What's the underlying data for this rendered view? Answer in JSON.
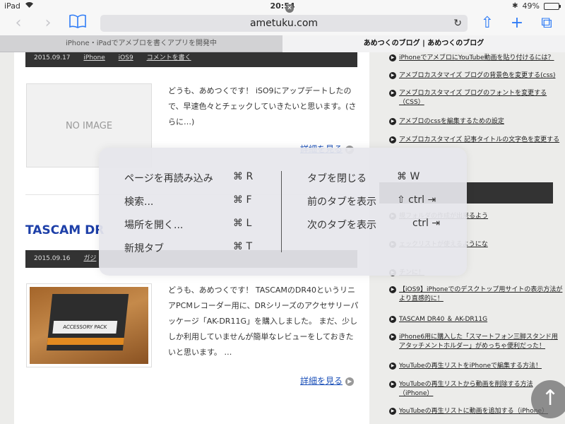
{
  "status": {
    "device": "iPad",
    "time": "20:54",
    "battery": "49%",
    "battery_level": 0.49
  },
  "toolbar": {
    "url": "ametuku.com",
    "back": "‹",
    "forward": "›",
    "share": "⇧",
    "add": "+",
    "tabs": "⧉"
  },
  "tabs": [
    {
      "label": "iPhone・iPadでアメブロを書くアプリを開発中"
    },
    {
      "label": "あめつくのブログ | あめつくのブログ"
    }
  ],
  "posts": [
    {
      "date": "2015.09.17",
      "category": "iPhone",
      "tag": "iOS9",
      "comment": "コメントを書く",
      "thumb": "NO IMAGE",
      "excerpt": "どうも、あめつくです！ iSO9にアップデートしたので、早速色々とチェックしていきたいと思います。(さらに…)",
      "more": "詳細を見る"
    },
    {
      "title": "TASCAM DR",
      "date": "2015.09.16",
      "category": "ガジ",
      "thumb_text": "ACCESSORY PACK",
      "excerpt": "どうも、あめつくです！ TASCAMのDR40というリニアPCMレコーダー用に、DRシリーズのアクセサリーパッケージ「AK-DR11G」を購入しました。 まだ、少ししか利用していませんが簡単なレビューをしておきたいと思います。 …",
      "more": "詳細を見る"
    }
  ],
  "sidebar": {
    "items_top": [
      "iPhoneでアメブロにYouTube動画を貼り付けるには？",
      "アメブロカスタマイズ ブログの背景色を変更する(css)",
      "アメブロカスタマイズ ブログのフォントを変更する（CSS）",
      "アメブロのcssを編集するための設定",
      "アメブロカスタマイズ 記事タイトルの文字色を変更する"
    ],
    "items_partial": [
      "規フォルダの作成が出来るよう",
      "ェックリストが使えるようにな",
      "チンに！"
    ],
    "items_bottom": [
      "【iOS9】iPhoneでのデスクトップ用サイトの表示方法がより直感的に！",
      "TASCAM DR40 ＆ AK-DR11G",
      "iPhone6用に購入した「スマートフォン三脚スタンド用アタッチメントホルダー」がめっちゃ便利だった！",
      "YouTubeの再生リストをiPhoneで編集する方法！",
      "YouTubeの再生リストから動画を削除する方法（iPhone）",
      "YouTubeの再生リストに動画を追加する（iPhone）"
    ]
  },
  "shortcuts": {
    "left": [
      {
        "label": "ページを再読み込み",
        "key": "⌘ R"
      },
      {
        "label": "検索...",
        "key": "⌘ F"
      },
      {
        "label": "場所を開く...",
        "key": "⌘ L"
      },
      {
        "label": "新規タブ",
        "key": "⌘ T"
      }
    ],
    "right": [
      {
        "label": "タブを閉じる",
        "key": "⌘ W"
      },
      {
        "label": "前のタブを表示",
        "key": "⇧ ctrl ⇥"
      },
      {
        "label": "次のタブを表示",
        "key": "ctrl ⇥"
      }
    ]
  },
  "scroll_up": "↑"
}
